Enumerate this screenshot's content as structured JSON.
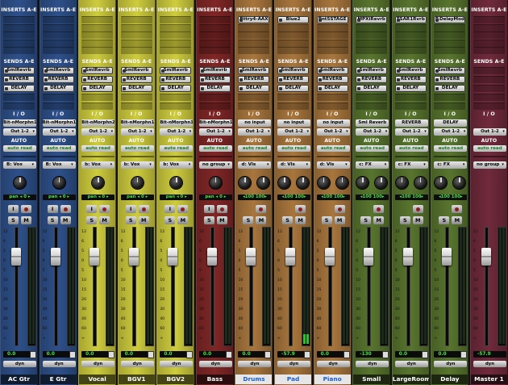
{
  "labels": {
    "inserts": "INSERTS A-E",
    "sends": "SENDS A-E",
    "io": "I / O",
    "auto": "AUTO",
    "input_btn": "I",
    "solo_btn": "S",
    "mute_btn": "M",
    "dyn_btn": "dyn",
    "fader_scale": [
      "12",
      "6",
      "5",
      "0",
      "5",
      "10",
      "15",
      "20",
      "30",
      "40",
      "60",
      "∞"
    ]
  },
  "colors": {
    "blue": "#2c4c83",
    "yellow": "#c4c23a",
    "red": "#7a2424",
    "orange": "#a0703a",
    "green": "#546f2c",
    "master": "#6b2838",
    "meter_green": "#2fbf2f",
    "readout_green": "#4be04b",
    "selected_name_text": "#1c5fc7"
  },
  "tracks": [
    {
      "name": "AC Gtr",
      "color": "blue",
      "inserts": [],
      "sends": [
        "SmlRevrb",
        "REVERB",
        "DELAY"
      ],
      "input": "Bit-nMorphn1",
      "output": "Out 1-2",
      "automation": "auto read",
      "group": "B: Vox",
      "pan": [
        "pan",
        "0"
      ],
      "volume": "0.0",
      "has_record": true,
      "selected": false,
      "meter_level": 0
    },
    {
      "name": "E Gtr",
      "color": "blue",
      "inserts": [],
      "sends": [
        "SmlRevrb",
        "REVERB",
        "DELAY"
      ],
      "input": "Bit-nMorphn1",
      "output": "Out 1-2",
      "automation": "auto read",
      "group": "B: Vox",
      "pan": [
        "pan",
        "0"
      ],
      "volume": "0.0",
      "has_record": true,
      "selected": false,
      "meter_level": 0
    },
    {
      "name": "Vocal",
      "color": "yellow",
      "inserts": [],
      "sends": [
        "SmlRevrb",
        "REVERB",
        "DELAY"
      ],
      "input": "Bit-nMorphn2",
      "output": "Out 1-2",
      "automation": "auto read",
      "group": "b: Vox",
      "pan": [
        "pan",
        "0"
      ],
      "volume": "0.0",
      "has_record": true,
      "selected": false,
      "meter_level": 0
    },
    {
      "name": "BGV1",
      "color": "yellow",
      "inserts": [],
      "sends": [
        "SmlRevrb",
        "REVERB",
        "DELAY"
      ],
      "input": "Bit-nMorphn1",
      "output": "Out 1-2",
      "automation": "auto read",
      "group": "b: Vox",
      "pan": [
        "pan",
        "0"
      ],
      "volume": "0.0",
      "has_record": true,
      "selected": false,
      "meter_level": 0
    },
    {
      "name": "BGV2",
      "color": "yellow",
      "inserts": [],
      "sends": [
        "SmlRevrb",
        "REVERB",
        "DELAY"
      ],
      "input": "Bit-nMorphn1",
      "output": "Out 1-2",
      "automation": "auto read",
      "group": "b: Vox",
      "pan": [
        "pan",
        "0"
      ],
      "volume": "0.0",
      "has_record": true,
      "selected": false,
      "meter_level": 0
    },
    {
      "name": "Bass",
      "color": "red",
      "inserts": [],
      "sends": [
        "SmlRevrb",
        "REVERB",
        "DELAY"
      ],
      "input": "Bit-nMorphn1",
      "output": "Out 1-2",
      "automation": "auto read",
      "group": "no group",
      "pan": [
        "pan",
        "0"
      ],
      "volume": "0.0",
      "has_record": true,
      "selected": false,
      "meter_level": 0
    },
    {
      "name": "Drums",
      "color": "orange",
      "inserts": [
        "Bttry4-AAX"
      ],
      "sends": [
        "SmlRevrb",
        "REVERB",
        "DELAY"
      ],
      "input": "no input",
      "output": "Out 1-2",
      "automation": "auto read",
      "group": "d: Vls",
      "pan": [
        "100",
        "100"
      ],
      "volume": "0.0",
      "has_record": false,
      "selected": true,
      "meter_level": 0
    },
    {
      "name": "Pad",
      "color": "orange",
      "inserts": [
        "Blue2"
      ],
      "sends": [
        "SmlRevrb",
        "REVERB",
        "DELAY"
      ],
      "input": "no input",
      "output": "Out 1-2",
      "automation": "auto read",
      "group": "d: Vls",
      "pan": [
        "100",
        "100"
      ],
      "volume": "-57.9",
      "has_record": false,
      "selected": true,
      "meter_level": 0.08
    },
    {
      "name": "Piano",
      "color": "orange",
      "inserts": [
        "Pnt5STAGE"
      ],
      "sends": [
        "SmlRevrb",
        "REVERB",
        "DELAY"
      ],
      "input": "no input",
      "output": "Out 1-2",
      "automation": "auto read",
      "group": "d: Vls",
      "pan": [
        "100",
        "100"
      ],
      "volume": "0.0",
      "has_record": false,
      "selected": true,
      "meter_level": 0
    },
    {
      "name": "Small room",
      "color": "green",
      "inserts": [
        "MPXiRevrb"
      ],
      "sends": [
        "SmlRevrb",
        "REVERB",
        "DELAY"
      ],
      "input": "Sml Reverb",
      "output": "Out 1-2",
      "automation": "auto read",
      "group": "c: FX",
      "pan": [
        "100",
        "100"
      ],
      "volume": "-130",
      "has_record": false,
      "selected": false,
      "meter_level": 0
    },
    {
      "name": "LargeRoom",
      "color": "green",
      "inserts": [
        "TSAR1Rvrb"
      ],
      "sends": [
        "SmlRevrb",
        "REVERB",
        "DELAY"
      ],
      "input": "REVERB",
      "output": "Out 1-2",
      "automation": "auto read",
      "group": "c: FX",
      "pan": [
        "100",
        "100"
      ],
      "volume": "0.0",
      "has_record": false,
      "selected": false,
      "meter_level": 0
    },
    {
      "name": "Delay",
      "color": "green",
      "inserts": [
        "P.DelayMod"
      ],
      "sends": [
        "SmlRevrb",
        "REVERB",
        "DELAY"
      ],
      "input": "DELAY",
      "output": "Out 1-2",
      "automation": "auto read",
      "group": "c: FX",
      "pan": [
        "100",
        "100"
      ],
      "volume": "0.0",
      "has_record": false,
      "selected": false,
      "meter_level": 0
    },
    {
      "name": "Master 1",
      "color": "master",
      "inserts": [],
      "sends": [],
      "input": "",
      "output": "Out 1-2",
      "automation": "auto read",
      "group": "no group",
      "pan": [],
      "volume": "-57.9",
      "has_record": false,
      "selected": false,
      "meter_level": 0
    }
  ]
}
